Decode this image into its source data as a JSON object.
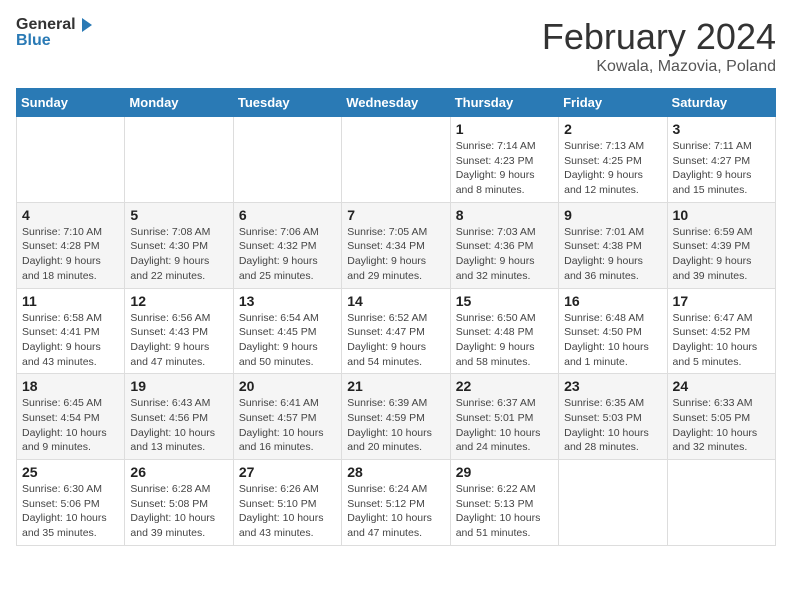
{
  "header": {
    "logo_general": "General",
    "logo_blue": "Blue",
    "title": "February 2024",
    "subtitle": "Kowala, Mazovia, Poland"
  },
  "columns": [
    "Sunday",
    "Monday",
    "Tuesday",
    "Wednesday",
    "Thursday",
    "Friday",
    "Saturday"
  ],
  "weeks": [
    [
      {
        "day": "",
        "info": ""
      },
      {
        "day": "",
        "info": ""
      },
      {
        "day": "",
        "info": ""
      },
      {
        "day": "",
        "info": ""
      },
      {
        "day": "1",
        "info": "Sunrise: 7:14 AM\nSunset: 4:23 PM\nDaylight: 9 hours\nand 8 minutes."
      },
      {
        "day": "2",
        "info": "Sunrise: 7:13 AM\nSunset: 4:25 PM\nDaylight: 9 hours\nand 12 minutes."
      },
      {
        "day": "3",
        "info": "Sunrise: 7:11 AM\nSunset: 4:27 PM\nDaylight: 9 hours\nand 15 minutes."
      }
    ],
    [
      {
        "day": "4",
        "info": "Sunrise: 7:10 AM\nSunset: 4:28 PM\nDaylight: 9 hours\nand 18 minutes."
      },
      {
        "day": "5",
        "info": "Sunrise: 7:08 AM\nSunset: 4:30 PM\nDaylight: 9 hours\nand 22 minutes."
      },
      {
        "day": "6",
        "info": "Sunrise: 7:06 AM\nSunset: 4:32 PM\nDaylight: 9 hours\nand 25 minutes."
      },
      {
        "day": "7",
        "info": "Sunrise: 7:05 AM\nSunset: 4:34 PM\nDaylight: 9 hours\nand 29 minutes."
      },
      {
        "day": "8",
        "info": "Sunrise: 7:03 AM\nSunset: 4:36 PM\nDaylight: 9 hours\nand 32 minutes."
      },
      {
        "day": "9",
        "info": "Sunrise: 7:01 AM\nSunset: 4:38 PM\nDaylight: 9 hours\nand 36 minutes."
      },
      {
        "day": "10",
        "info": "Sunrise: 6:59 AM\nSunset: 4:39 PM\nDaylight: 9 hours\nand 39 minutes."
      }
    ],
    [
      {
        "day": "11",
        "info": "Sunrise: 6:58 AM\nSunset: 4:41 PM\nDaylight: 9 hours\nand 43 minutes."
      },
      {
        "day": "12",
        "info": "Sunrise: 6:56 AM\nSunset: 4:43 PM\nDaylight: 9 hours\nand 47 minutes."
      },
      {
        "day": "13",
        "info": "Sunrise: 6:54 AM\nSunset: 4:45 PM\nDaylight: 9 hours\nand 50 minutes."
      },
      {
        "day": "14",
        "info": "Sunrise: 6:52 AM\nSunset: 4:47 PM\nDaylight: 9 hours\nand 54 minutes."
      },
      {
        "day": "15",
        "info": "Sunrise: 6:50 AM\nSunset: 4:48 PM\nDaylight: 9 hours\nand 58 minutes."
      },
      {
        "day": "16",
        "info": "Sunrise: 6:48 AM\nSunset: 4:50 PM\nDaylight: 10 hours\nand 1 minute."
      },
      {
        "day": "17",
        "info": "Sunrise: 6:47 AM\nSunset: 4:52 PM\nDaylight: 10 hours\nand 5 minutes."
      }
    ],
    [
      {
        "day": "18",
        "info": "Sunrise: 6:45 AM\nSunset: 4:54 PM\nDaylight: 10 hours\nand 9 minutes."
      },
      {
        "day": "19",
        "info": "Sunrise: 6:43 AM\nSunset: 4:56 PM\nDaylight: 10 hours\nand 13 minutes."
      },
      {
        "day": "20",
        "info": "Sunrise: 6:41 AM\nSunset: 4:57 PM\nDaylight: 10 hours\nand 16 minutes."
      },
      {
        "day": "21",
        "info": "Sunrise: 6:39 AM\nSunset: 4:59 PM\nDaylight: 10 hours\nand 20 minutes."
      },
      {
        "day": "22",
        "info": "Sunrise: 6:37 AM\nSunset: 5:01 PM\nDaylight: 10 hours\nand 24 minutes."
      },
      {
        "day": "23",
        "info": "Sunrise: 6:35 AM\nSunset: 5:03 PM\nDaylight: 10 hours\nand 28 minutes."
      },
      {
        "day": "24",
        "info": "Sunrise: 6:33 AM\nSunset: 5:05 PM\nDaylight: 10 hours\nand 32 minutes."
      }
    ],
    [
      {
        "day": "25",
        "info": "Sunrise: 6:30 AM\nSunset: 5:06 PM\nDaylight: 10 hours\nand 35 minutes."
      },
      {
        "day": "26",
        "info": "Sunrise: 6:28 AM\nSunset: 5:08 PM\nDaylight: 10 hours\nand 39 minutes."
      },
      {
        "day": "27",
        "info": "Sunrise: 6:26 AM\nSunset: 5:10 PM\nDaylight: 10 hours\nand 43 minutes."
      },
      {
        "day": "28",
        "info": "Sunrise: 6:24 AM\nSunset: 5:12 PM\nDaylight: 10 hours\nand 47 minutes."
      },
      {
        "day": "29",
        "info": "Sunrise: 6:22 AM\nSunset: 5:13 PM\nDaylight: 10 hours\nand 51 minutes."
      },
      {
        "day": "",
        "info": ""
      },
      {
        "day": "",
        "info": ""
      }
    ]
  ]
}
